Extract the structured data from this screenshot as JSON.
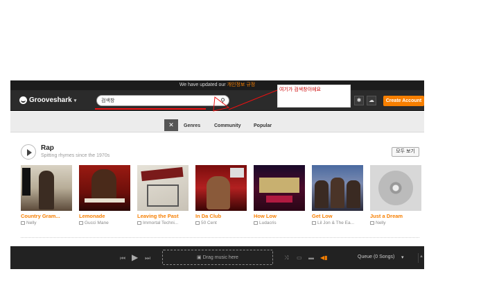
{
  "notice": {
    "text": "We have updated our",
    "link": "개인정보 규정"
  },
  "header": {
    "logo_text": "Grooveshark",
    "search_value": "검색창",
    "search_placeholder": "",
    "create_account_label": "Create Account"
  },
  "annotation": {
    "text": "여기가 검색창이에요",
    "color": "#e11111"
  },
  "subnav": {
    "tabs": [
      {
        "label": "Genres"
      },
      {
        "label": "Community"
      },
      {
        "label": "Popular"
      }
    ]
  },
  "section": {
    "title": "Rap",
    "subtitle": "Spitting rhymes since the 1970s",
    "view_all_label": "모두 보기"
  },
  "albums": [
    {
      "title": "Country Gram...",
      "artist": "Nelly"
    },
    {
      "title": "Lemonade",
      "artist": "Gucci Mane"
    },
    {
      "title": "Leaving the Past",
      "artist": "Immortal Techni..."
    },
    {
      "title": "In Da Club",
      "artist": "50 Cent"
    },
    {
      "title": "How Low",
      "artist": "Ludacris"
    },
    {
      "title": "Get Low",
      "artist": "Lil Jon & The Ea..."
    },
    {
      "title": "Just a Dream",
      "artist": "Nelly"
    }
  ],
  "player": {
    "drop_label": "Drag music here",
    "queue_label": "Queue (0 Songs)"
  },
  "colors": {
    "accent": "#f77f00",
    "header_bg": "#2b2b2b",
    "player_bg": "#222222"
  }
}
